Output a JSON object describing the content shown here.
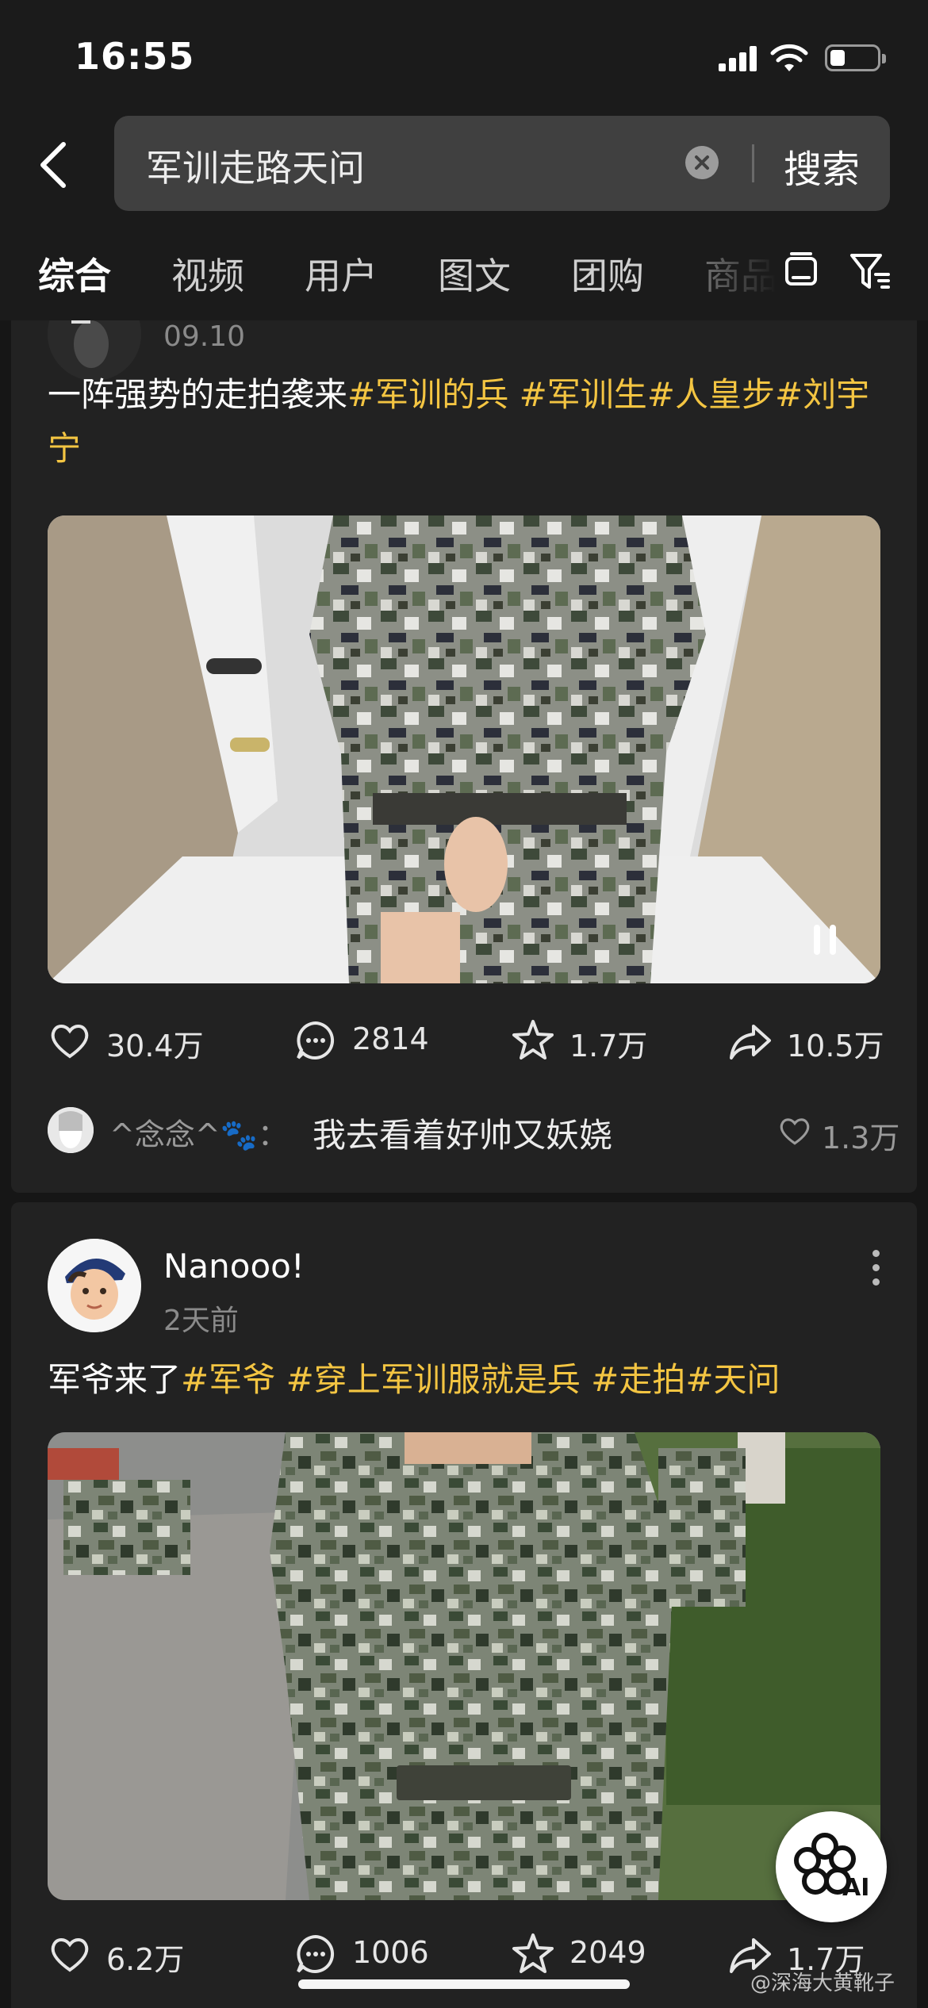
{
  "status_bar": {
    "time": "16:55",
    "icons": [
      "signal-icon",
      "wifi-icon",
      "battery-icon"
    ]
  },
  "search": {
    "query": "军训走路天问",
    "submit_label": "搜索",
    "icons": [
      "back-icon",
      "clear-icon"
    ]
  },
  "tabs": [
    {
      "label": "综合",
      "active": true
    },
    {
      "label": "视频"
    },
    {
      "label": "用户"
    },
    {
      "label": "图文"
    },
    {
      "label": "团购"
    },
    {
      "label": "商品"
    }
  ],
  "posts": [
    {
      "date": "09.10",
      "text_plain": "一阵强势的走拍袭来",
      "hashtags": [
        "#军训的兵",
        "#军训生",
        "#人皇步",
        "#刘宇宁"
      ],
      "stats": {
        "likes": "30.4万",
        "comments": "2814",
        "favorites": "1.7万",
        "shares": "10.5万"
      },
      "top_comment": {
        "user": "^念念^🐾：",
        "text": "我去看着好帅又妖娆",
        "likes": "1.3万"
      }
    },
    {
      "author": "Nanooo!",
      "date": "2天前",
      "text_plain": "军爷来了",
      "hashtags": [
        "#军爷",
        "#穿上军训服就是兵",
        "#走拍",
        "#天问"
      ],
      "stats": {
        "likes": "6.2万",
        "comments": "1006",
        "favorites": "2049",
        "shares": "1.7万"
      }
    }
  ],
  "ai_button_label": "AI",
  "watermark": "@深海大黄靴子",
  "colors": {
    "hashtag": "#f4c542",
    "background": "#161616",
    "card": "#222222"
  }
}
